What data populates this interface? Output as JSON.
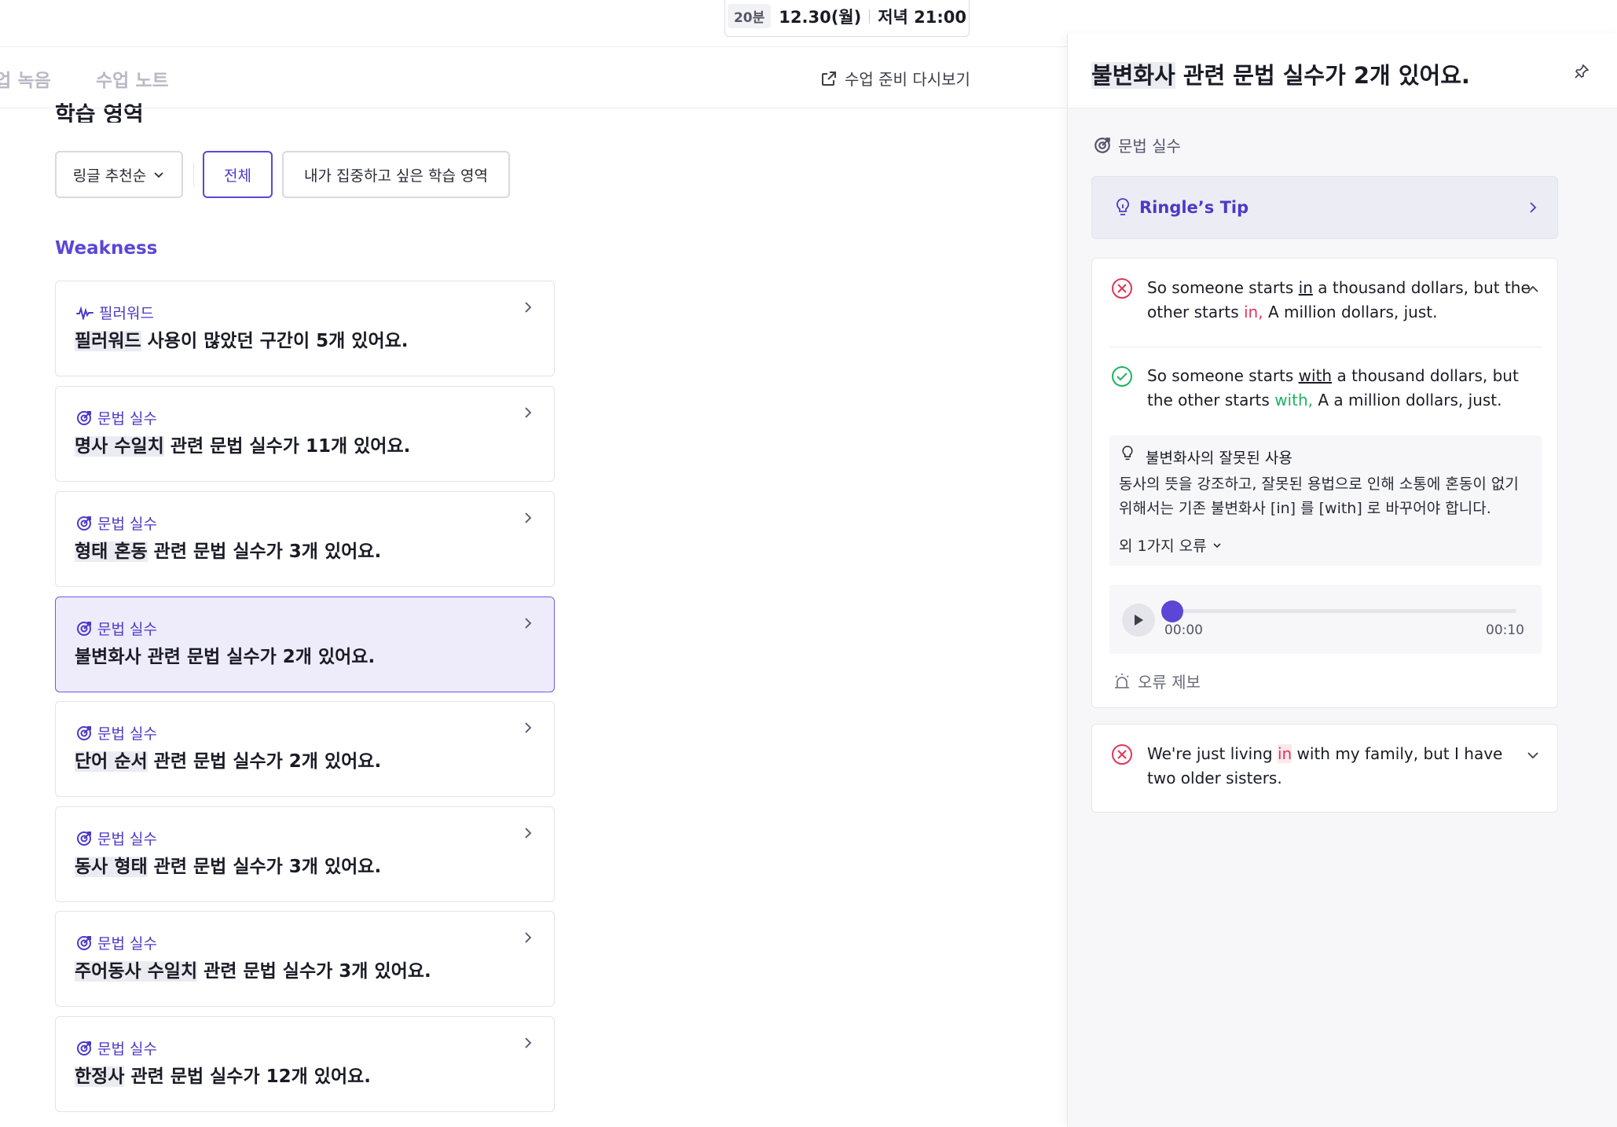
{
  "session": {
    "duration": "20분",
    "date": "12.30(월)",
    "time": "저녁 21:00"
  },
  "nav": {
    "tab_recording": "수업 녹음",
    "tab_notes": "수업 노트",
    "review_label": "수업 준비 다시보기"
  },
  "learning": {
    "section_title": "학습 영역",
    "filter_sort": "링글 추천순",
    "filter_all": "전체",
    "filter_focus": "내가 집중하고 싶은 학습 영역",
    "weakness_heading": "Weakness"
  },
  "cards": [
    {
      "category": "필러워드",
      "title_hl": "필러워드",
      "title_rest": " 사용이 많았던 구간이 5개 있어요.",
      "icon": "waveform-icon"
    },
    {
      "category": "문법 실수",
      "title_hl": "명사 수일치",
      "title_rest": " 관련 문법 실수가 11개 있어요.",
      "icon": "target-icon"
    },
    {
      "category": "문법 실수",
      "title_hl": "형태 혼동",
      "title_rest": " 관련 문법 실수가 3개 있어요.",
      "icon": "target-icon"
    },
    {
      "category": "문법 실수",
      "title_hl": "불변화사",
      "title_rest": " 관련 문법 실수가 2개 있어요.",
      "icon": "target-icon"
    },
    {
      "category": "문법 실수",
      "title_hl": "단어 순서",
      "title_rest": " 관련 문법 실수가 2개 있어요.",
      "icon": "target-icon"
    },
    {
      "category": "문법 실수",
      "title_hl": "동사 형태",
      "title_rest": " 관련 문법 실수가 3개 있어요.",
      "icon": "target-icon"
    },
    {
      "category": "문법 실수",
      "title_hl": "주어동사 수일치",
      "title_rest": " 관련 문법 실수가 3개 있어요.",
      "icon": "target-icon"
    },
    {
      "category": "문법 실수",
      "title_hl": "한정사",
      "title_rest": " 관련 문법 실수가 12개 있어요.",
      "icon": "target-icon"
    }
  ],
  "panel": {
    "title_hl": "불변화사",
    "title_rest": " 관련 문법 실수가 2개 있어요.",
    "category": "문법 실수",
    "tip_label": "Ringle’s Tip",
    "error1": {
      "wrong": {
        "a": "So someone starts ",
        "b": "in",
        "c": " a thousand dollars, but the other starts ",
        "d": "in,",
        "e": " A million dollars, just."
      },
      "right": {
        "a": "So someone starts ",
        "b": "with",
        "c": " a thousand dollars, but the other starts ",
        "d": "with,",
        "e": " A a million dollars, just."
      },
      "explain_title": "불변화사의 잘못된 사용",
      "explain_body": "동사의 뜻을 강조하고, 잘못된 용법으로 인해 소통에 혼동이 없기 위해서는 기존 불변화사 [in] 를 [with] 로 바꾸어야 합니다.",
      "more_errors": "외 1가지 오류"
    },
    "player": {
      "start": "00:00",
      "end": "00:10",
      "progress": 0.0
    },
    "report_label": "오류 제보",
    "error2": {
      "a": "We're just living ",
      "b": "in",
      "c": " with my family, but I have two older sisters."
    }
  },
  "colors": {
    "accent": "#5b46d6",
    "error": "#e0365a",
    "correct": "#1fb163"
  }
}
